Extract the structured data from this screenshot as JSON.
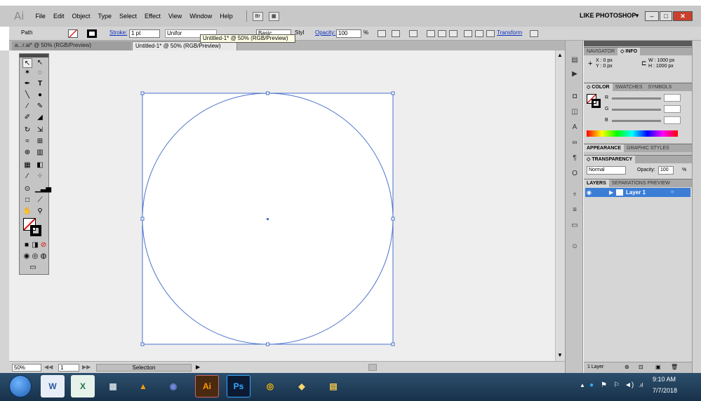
{
  "app": {
    "logo": "Ai",
    "workspace": "LIKE PHOTOSHOP"
  },
  "menu": [
    "File",
    "Edit",
    "Object",
    "Type",
    "Select",
    "Effect",
    "View",
    "Window",
    "Help"
  ],
  "menu_buttons": [
    "Br",
    "▦"
  ],
  "control": {
    "selection_type": "Path",
    "stroke_label": "Stroke:",
    "stroke_weight": "1 pt",
    "uniform_label": "Unifor",
    "basic_label": "Basic",
    "style_label": "Styl",
    "opacity_label": "Opacity:",
    "opacity_value": "100",
    "percent": "%",
    "transform_label": "Transform"
  },
  "tabs": [
    {
      "label": "a...r.ai* @ 50% (RGB/Preview)"
    },
    {
      "label": "Untitled-1* @ 50% (RGB/Preview)"
    }
  ],
  "tooltip": "Untitled-1* @ 50% (RGB/Preview)",
  "status": {
    "zoom": "50%",
    "page": "1",
    "mode": "Selection"
  },
  "info": {
    "x": "X : 0 px",
    "y": "Y : 0 px",
    "w": "W : 1000 px",
    "h": "H : 1000 px"
  },
  "panels": {
    "nav_tabs": [
      "NAVIGATOR",
      "◇ INFO"
    ],
    "color_tabs": [
      "◇ COLOR",
      "SWATCHES",
      "SYMBOLS"
    ],
    "color_channels": [
      "R",
      "G",
      "B"
    ],
    "appearance_tabs": [
      "APPEARANCE",
      "GRAPHIC STYLES"
    ],
    "transparency_tab": "◇ TRANSPARENCY",
    "blend_mode": "Normal",
    "opacity_label": "Opacity:",
    "opacity_value": "100",
    "percent": "%",
    "layers_tabs": [
      "LAYERS",
      "SEPARATIONS PREVIEW"
    ],
    "layer_name": "Layer 1",
    "layer_count": "1 Layer"
  },
  "taskbar": {
    "apps": [
      "W",
      "X",
      "▦",
      "▲",
      "◉",
      "Ai",
      "Ps",
      "◎",
      "◆",
      "▤"
    ],
    "time": "9:10 AM",
    "date": "7/7/2018"
  },
  "colors": {
    "accent": "#3c7ed6",
    "selection": "#4a72cc",
    "artboard": "#ffffff"
  }
}
